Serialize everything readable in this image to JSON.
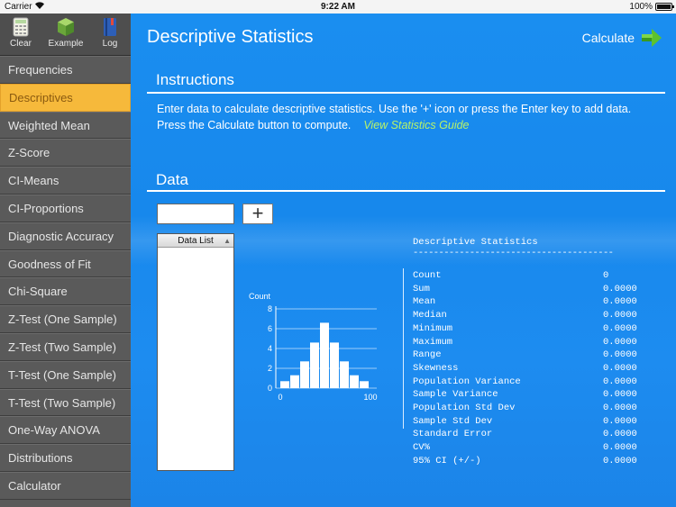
{
  "status_bar": {
    "carrier": "Carrier",
    "time": "9:22 AM",
    "battery": "100%"
  },
  "toolbar": {
    "clear": "Clear",
    "example": "Example",
    "log": "Log"
  },
  "sidebar": {
    "items": [
      {
        "label": "Frequencies"
      },
      {
        "label": "Descriptives",
        "active": true
      },
      {
        "label": "Weighted Mean"
      },
      {
        "label": "Z-Score"
      },
      {
        "label": "CI-Means"
      },
      {
        "label": "CI-Proportions"
      },
      {
        "label": "Diagnostic Accuracy"
      },
      {
        "label": "Goodness of Fit"
      },
      {
        "label": "Chi-Square"
      },
      {
        "label": "Z-Test (One Sample)"
      },
      {
        "label": "Z-Test (Two Sample)"
      },
      {
        "label": "T-Test (One Sample)"
      },
      {
        "label": "T-Test (Two Sample)"
      },
      {
        "label": "One-Way ANOVA"
      },
      {
        "label": "Distributions"
      },
      {
        "label": "Calculator"
      }
    ]
  },
  "main": {
    "title": "Descriptive Statistics",
    "calculate_label": "Calculate",
    "instructions_heading": "Instructions",
    "instructions_text": "Enter data to calculate descriptive statistics.  Use the '+' icon or press the Enter key to add data.  Press the Calculate button to compute.",
    "guide_link": "View Statistics Guide",
    "data_heading": "Data",
    "data_input_value": "",
    "add_button": "+",
    "data_list_header": "Data List",
    "data_list_sort": "▲"
  },
  "stats": {
    "title": "Descriptive Statistics",
    "divider": "---------------------------------------",
    "rows": [
      {
        "label": "Count",
        "value": "0"
      },
      {
        "label": "Sum",
        "value": "0.0000"
      },
      {
        "label": "Mean",
        "value": "0.0000"
      },
      {
        "label": "Median",
        "value": "0.0000"
      },
      {
        "label": "Minimum",
        "value": "0.0000"
      },
      {
        "label": "Maximum",
        "value": "0.0000"
      },
      {
        "label": "Range",
        "value": "0.0000"
      },
      {
        "label": "Skewness",
        "value": "0.0000"
      },
      {
        "label": "Population Variance",
        "value": "0.0000"
      },
      {
        "label": "Sample Variance",
        "value": "0.0000"
      },
      {
        "label": "Population Std Dev",
        "value": "0.0000"
      },
      {
        "label": "Sample Std Dev",
        "value": "0.0000"
      },
      {
        "label": "Standard Error",
        "value": "0.0000"
      },
      {
        "label": "CV%",
        "value": "0.0000"
      },
      {
        "label": "95% CI (+/-)",
        "value": "0.0000"
      }
    ]
  },
  "chart_data": {
    "type": "bar",
    "ylabel": "Count",
    "ylim": [
      0,
      8
    ],
    "xlim": [
      0,
      100
    ],
    "yticks": [
      "0",
      "2",
      "4",
      "6",
      "8"
    ],
    "xticks": [
      "0",
      "100"
    ],
    "values": [
      0.7,
      1.3,
      2.7,
      4.6,
      6.6,
      4.6,
      2.7,
      1.3,
      0.7
    ],
    "grid": true
  }
}
